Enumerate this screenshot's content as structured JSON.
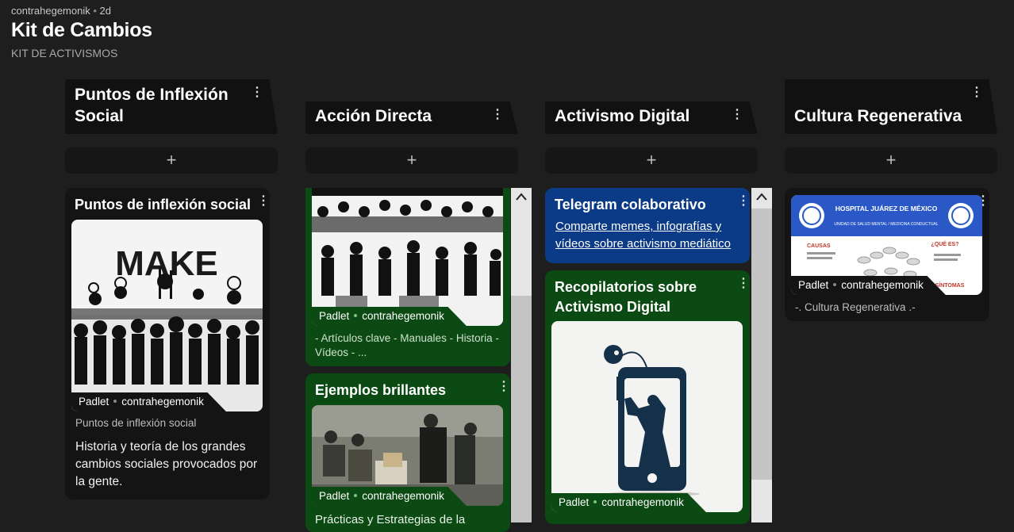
{
  "header": {
    "author": "contrahegemonik",
    "age": "2d",
    "title": "Kit de Cambios",
    "subtitle": "KIT DE ACTIVISMOS"
  },
  "add_label": "+",
  "columns": [
    {
      "title": "Puntos de Inflexión Social",
      "cards": [
        {
          "title": "Puntos de inflexión social",
          "image_text": "MAKE",
          "tag_source": "Padlet",
          "tag_author": "contrahegemonik",
          "caption": "Puntos de inflexión social",
          "body": "Historia y teoría de los grandes cambios sociales provocados por la gente."
        }
      ]
    },
    {
      "title": "Acción Directa",
      "cards": [
        {
          "tag_source": "Padlet",
          "tag_author": "contrahegemonik",
          "body": "- Artículos clave - Manuales - Historia - Vídeos - ..."
        },
        {
          "title": "Ejemplos brillantes",
          "tag_source": "Padlet",
          "tag_author": "contrahegemonik",
          "body": "Prácticas y Estrategias de la"
        }
      ]
    },
    {
      "title": "Activismo Digital",
      "cards": [
        {
          "title": "Telegram colaborativo",
          "link": "Comparte memes, infografías y vídeos sobre activismo mediático"
        },
        {
          "title": "Recopilatorios sobre Activismo Digital",
          "tag_source": "Padlet",
          "tag_author": "contrahegemonik"
        }
      ]
    },
    {
      "title": "Cultura Regenerativa",
      "cards": [
        {
          "poster_title": "HOSPITAL JUÁREZ DE MÉXICO",
          "poster_sub": "UNIDAD DE SALUD MENTAL / MEDICINA CONDUCTUAL",
          "poster_causas": "CAUSAS",
          "poster_que": "¿QUÉ ES?",
          "poster_sintomas": "SÍNTOMAS",
          "tag_source": "Padlet",
          "tag_author": "contrahegemonik",
          "caption": "-. Cultura Regenerativa .-"
        }
      ]
    }
  ],
  "colors": {
    "green_card": "#0b4a12",
    "blue_card": "#0b3a86",
    "dark_card": "#141415"
  }
}
